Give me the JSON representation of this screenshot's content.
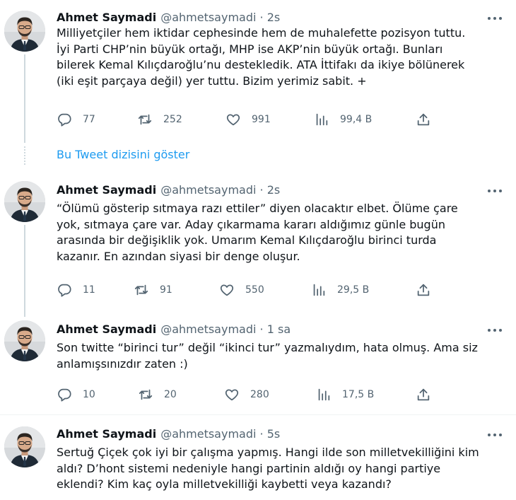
{
  "author": {
    "name": "Ahmet Saymadi",
    "handle": "@ahmetsaymadi",
    "separator": "·"
  },
  "show_thread_label": "Bu Tweet dizisini göster",
  "tweets": [
    {
      "time": "2s",
      "text": "Milliyetçiler hem iktidar cephesinde hem de muhalefette pozisyon tuttu.\nİyi Parti CHP’nin büyük ortağı, MHP ise AKP’nin büyük ortağı. Bunları\nbilerek Kemal Kılıçdaroğlu’nu destekledik. ATA İttifakı da ikiye bölünerek\n(iki eşit parçaya değil) yer tuttu. Bizim yerimiz sabit. +",
      "replies": "77",
      "retweets": "252",
      "likes": "991",
      "views": "99,4 B"
    },
    {
      "time": "2s",
      "text": "“Ölümü gösterip sıtmaya razı ettiler” diyen olacaktır elbet. Ölüme çare\nyok, sıtmaya çare var. Aday çıkarmama kararı aldığımız günle bugün\narasında bir değişiklik yok. Umarım Kemal Kılıçdaroğlu birinci turda\nkazanır. En azından siyasi bir denge oluşur.",
      "replies": "11",
      "retweets": "91",
      "likes": "550",
      "views": "29,5 B"
    },
    {
      "time": "1 sa",
      "text": "Son twitte “birinci tur” değil “ikinci tur” yazmalıydım, hata olmuş. Ama siz\nanlamışsınızdır zaten :)",
      "replies": "10",
      "retweets": "20",
      "likes": "280",
      "views": "17,5 B"
    },
    {
      "time": "5s",
      "text": "Sertuğ Çiçek çok iyi bir çalışma yapmış. Hangi ilde son milletvekilliğini kim\naldı? D’hont sistemi nedeniyle hangi partinin aldığı oy hangi partiye\neklendi? Kim kaç oyla milletvekilliği kaybetti veya kazandı?"
    }
  ],
  "icons": {
    "reply": "reply-icon",
    "retweet": "retweet-icon",
    "like": "heart-icon",
    "views": "views-bar-chart-icon",
    "share": "share-upload-icon",
    "more": "more-dots-icon"
  },
  "colors": {
    "link": "#1d9bf0",
    "secondary_text": "#536471",
    "thread_line": "#cfd9de"
  }
}
